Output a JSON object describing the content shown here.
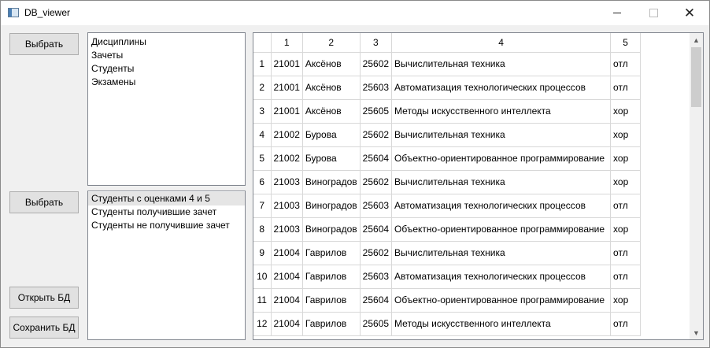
{
  "window": {
    "title": "DB_viewer",
    "minimize_icon": "minimize-icon",
    "maximize_icon": "maximize-icon",
    "close_icon": "close-icon",
    "close_glyph": "✕"
  },
  "controls": {
    "select_tables_label": "Выбрать",
    "select_queries_label": "Выбрать",
    "open_db_label": "Открыть БД",
    "save_db_label": "Сохранить БД"
  },
  "tables_list": {
    "items": [
      "Дисциплины",
      "Зачеты",
      "Студенты",
      "Экзамены"
    ]
  },
  "queries_list": {
    "selected_index": 0,
    "items": [
      "Студенты с оценками 4 и 5",
      "Студенты получившие зачет",
      "Студенты не получившие зачет"
    ]
  },
  "grid": {
    "columns": [
      "1",
      "2",
      "3",
      "4",
      "5"
    ],
    "rows": [
      {
        "num": "1",
        "cells": [
          "21001",
          "Аксёнов",
          "25602",
          "Вычислительная техника",
          "отл"
        ]
      },
      {
        "num": "2",
        "cells": [
          "21001",
          "Аксёнов",
          "25603",
          "Автоматизация технологических процессов",
          "отл"
        ]
      },
      {
        "num": "3",
        "cells": [
          "21001",
          "Аксёнов",
          "25605",
          "Методы искусственного интеллекта",
          "хор"
        ]
      },
      {
        "num": "4",
        "cells": [
          "21002",
          "Бурова",
          "25602",
          "Вычислительная техника",
          "хор"
        ]
      },
      {
        "num": "5",
        "cells": [
          "21002",
          "Бурова",
          "25604",
          "Объектно-ориентированное программирование",
          "хор"
        ]
      },
      {
        "num": "6",
        "cells": [
          "21003",
          "Виноградов",
          "25602",
          "Вычислительная техника",
          "хор"
        ]
      },
      {
        "num": "7",
        "cells": [
          "21003",
          "Виноградов",
          "25603",
          "Автоматизация технологических процессов",
          "отл"
        ]
      },
      {
        "num": "8",
        "cells": [
          "21003",
          "Виноградов",
          "25604",
          "Объектно-ориентированное программирование",
          "хор"
        ]
      },
      {
        "num": "9",
        "cells": [
          "21004",
          "Гаврилов",
          "25602",
          "Вычислительная техника",
          "отл"
        ]
      },
      {
        "num": "10",
        "cells": [
          "21004",
          "Гаврилов",
          "25603",
          "Автоматизация технологических процессов",
          "отл"
        ]
      },
      {
        "num": "11",
        "cells": [
          "21004",
          "Гаврилов",
          "25604",
          "Объектно-ориентированное программирование",
          "хор"
        ]
      },
      {
        "num": "12",
        "cells": [
          "21004",
          "Гаврилов",
          "25605",
          "Методы искусственного интеллекта",
          "отл"
        ]
      }
    ],
    "scroll_up_icon": "chevron-up-icon",
    "scroll_down_icon": "chevron-down-icon",
    "scroll_up_glyph": "▲",
    "scroll_down_glyph": "▼"
  }
}
